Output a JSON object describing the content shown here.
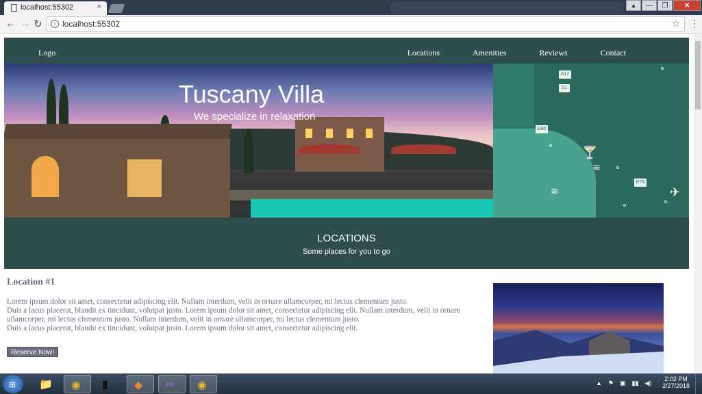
{
  "browser": {
    "tab_title": "localhost:55302",
    "tab_close": "×",
    "url": "localhost:55302",
    "back_glyph": "←",
    "forward_glyph": "→",
    "reload_glyph": "↻",
    "info_glyph": "i",
    "star_glyph": "☆",
    "menu_glyph": "⋮",
    "window_controls": [
      "▴",
      "—",
      "❐",
      "✕"
    ]
  },
  "site": {
    "logo": "Logo",
    "nav": [
      "Locations",
      "Amenities",
      "Reviews",
      "Contact"
    ]
  },
  "hero": {
    "title": "Tuscany Villa",
    "subtitle": "We specialize in relaxation"
  },
  "map": {
    "road_labels": [
      "A12",
      "S1",
      "E80",
      "E78"
    ]
  },
  "locations_section": {
    "heading": "LOCATIONS",
    "subheading": "Some places for you to go"
  },
  "location_1": {
    "title": "Location #1",
    "paragraphs": [
      "Lorem ipsum dolor sit amet, consectetur adipiscing elit. Nullam interdum, velit in ornare ullamcorper, mi lectus clementum justo.",
      "Duis a lacus placerat, blandit ex tincidunt, volutpat justo. Lorem ipsum dolor sit amet, consectetur adipiscing elit. Nullam interdum, velit in ornare ullamcorper, mi lectus clementum justo. Nullam interdum, velit in ornare ullamcorper, mi lectus clementum justo.",
      "Duis a lacus placerat, blandit ex tincidunt, volutpat justo. Lorem ipsum dolor sit amet, consectetur adipiscing elit."
    ],
    "button": "Reserve Now!"
  },
  "taskbar": {
    "start_glyph": "⊞",
    "apps": [
      {
        "name": "file-explorer",
        "glyph": "📁"
      },
      {
        "name": "chrome",
        "glyph": "◉"
      },
      {
        "name": "terminal",
        "glyph": "▮"
      },
      {
        "name": "git-tool",
        "glyph": "◆"
      },
      {
        "name": "visual-studio",
        "glyph": "∞"
      },
      {
        "name": "chrome-active",
        "glyph": "◉"
      }
    ],
    "tray_glyphs": [
      "▲",
      "⚑",
      "▣",
      "▮▮",
      "◀)"
    ],
    "time": "2:02 PM",
    "date": "2/27/2018"
  }
}
